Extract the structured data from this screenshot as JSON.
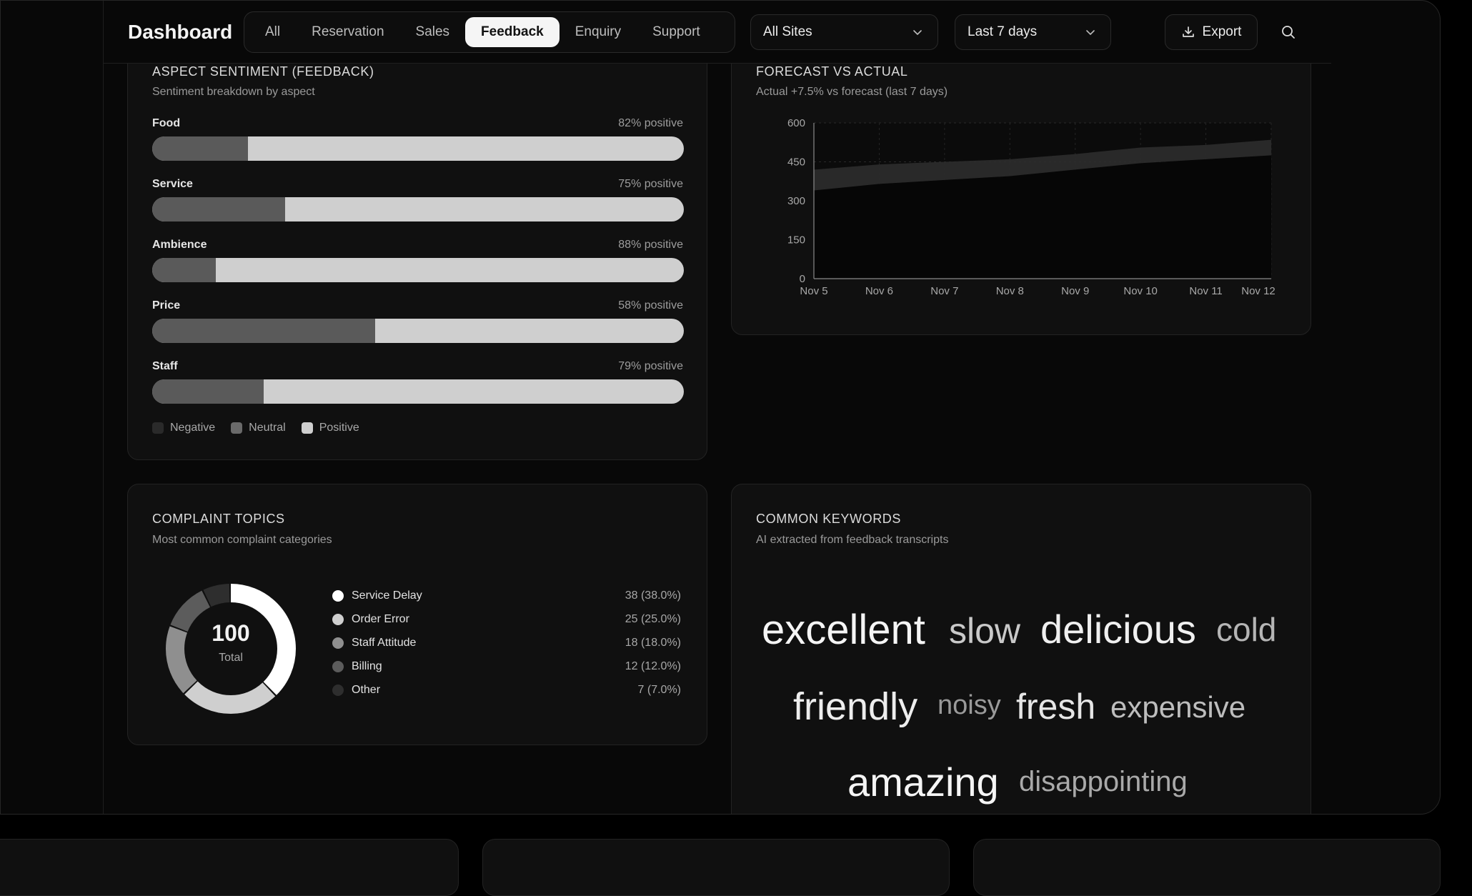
{
  "header": {
    "title": "Dashboard",
    "tabs": [
      {
        "label": "All"
      },
      {
        "label": "Reservation"
      },
      {
        "label": "Sales"
      },
      {
        "label": "Feedback"
      },
      {
        "label": "Enquiry"
      },
      {
        "label": "Support"
      }
    ],
    "active_tab": "Feedback",
    "site_select": "All Sites",
    "range_select": "Last 7 days",
    "export_label": "Export"
  },
  "aspect": {
    "title": "ASPECT SENTIMENT (FEEDBACK)",
    "subtitle": "Sentiment breakdown by aspect",
    "rows": [
      {
        "label": "Food",
        "value": "82% positive",
        "negative_frac": 0.18
      },
      {
        "label": "Service",
        "value": "75% positive",
        "negative_frac": 0.25
      },
      {
        "label": "Ambience",
        "value": "88% positive",
        "negative_frac": 0.12
      },
      {
        "label": "Price",
        "value": "58% positive",
        "negative_frac": 0.42
      },
      {
        "label": "Staff",
        "value": "79% positive",
        "negative_frac": 0.21
      }
    ],
    "legend": [
      {
        "label": "Negative",
        "color": "#2a2a2a"
      },
      {
        "label": "Neutral",
        "color": "#6a6a6a"
      },
      {
        "label": "Positive",
        "color": "#cfcfcf"
      }
    ],
    "colors": {
      "negative": "#5a5a5a",
      "positive": "#cfcfcf"
    }
  },
  "forecast": {
    "title": "FORECAST VS ACTUAL",
    "subtitle": "Actual +7.5% vs forecast (last 7 days)"
  },
  "chart_data": {
    "type": "area",
    "x": [
      "Nov 5",
      "Nov 6",
      "Nov 7",
      "Nov 8",
      "Nov 9",
      "Nov 10",
      "Nov 11",
      "Nov 12"
    ],
    "series": [
      {
        "values": [
          340,
          365,
          380,
          395,
          420,
          445,
          460,
          475
        ]
      },
      {
        "values": [
          420,
          440,
          450,
          460,
          480,
          505,
          515,
          535
        ]
      }
    ],
    "yticks": [
      0,
      150,
      300,
      450,
      600
    ],
    "ylim": [
      0,
      600
    ],
    "grid": true
  },
  "complaints": {
    "title": "COMPLAINT TOPICS",
    "subtitle": "Most common complaint categories",
    "total": "100",
    "total_label": "Total",
    "items": [
      {
        "name": "Service Delay",
        "value": "38 (38.0%)",
        "count": 38,
        "color": "#ffffff"
      },
      {
        "name": "Order Error",
        "value": "25 (25.0%)",
        "count": 25,
        "color": "#cfcfcf"
      },
      {
        "name": "Staff Attitude",
        "value": "18 (18.0%)",
        "count": 18,
        "color": "#8f8f8f"
      },
      {
        "name": "Billing",
        "value": "12 (12.0%)",
        "count": 12,
        "color": "#5c5c5c"
      },
      {
        "name": "Other",
        "value": "7 (7.0%)",
        "count": 7,
        "color": "#2e2e2e"
      }
    ]
  },
  "keywords": {
    "title": "COMMON KEYWORDS",
    "subtitle": "AI extracted from feedback transcripts",
    "words": [
      {
        "text": "excellent",
        "color": "#f5f5f5"
      },
      {
        "text": "slow",
        "color": "#c9c9c9"
      },
      {
        "text": "delicious",
        "color": "#f0f0f0"
      },
      {
        "text": "cold",
        "color": "#b5b5b5"
      },
      {
        "text": "friendly",
        "color": "#ededed"
      },
      {
        "text": "noisy",
        "color": "#9a9a9a"
      },
      {
        "text": "fresh",
        "color": "#e6e6e6"
      },
      {
        "text": "expensive",
        "color": "#bdbdbd"
      },
      {
        "text": "amazing",
        "color": "#f5f5f5"
      },
      {
        "text": "disappointing",
        "color": "#a9a9a9"
      }
    ]
  }
}
